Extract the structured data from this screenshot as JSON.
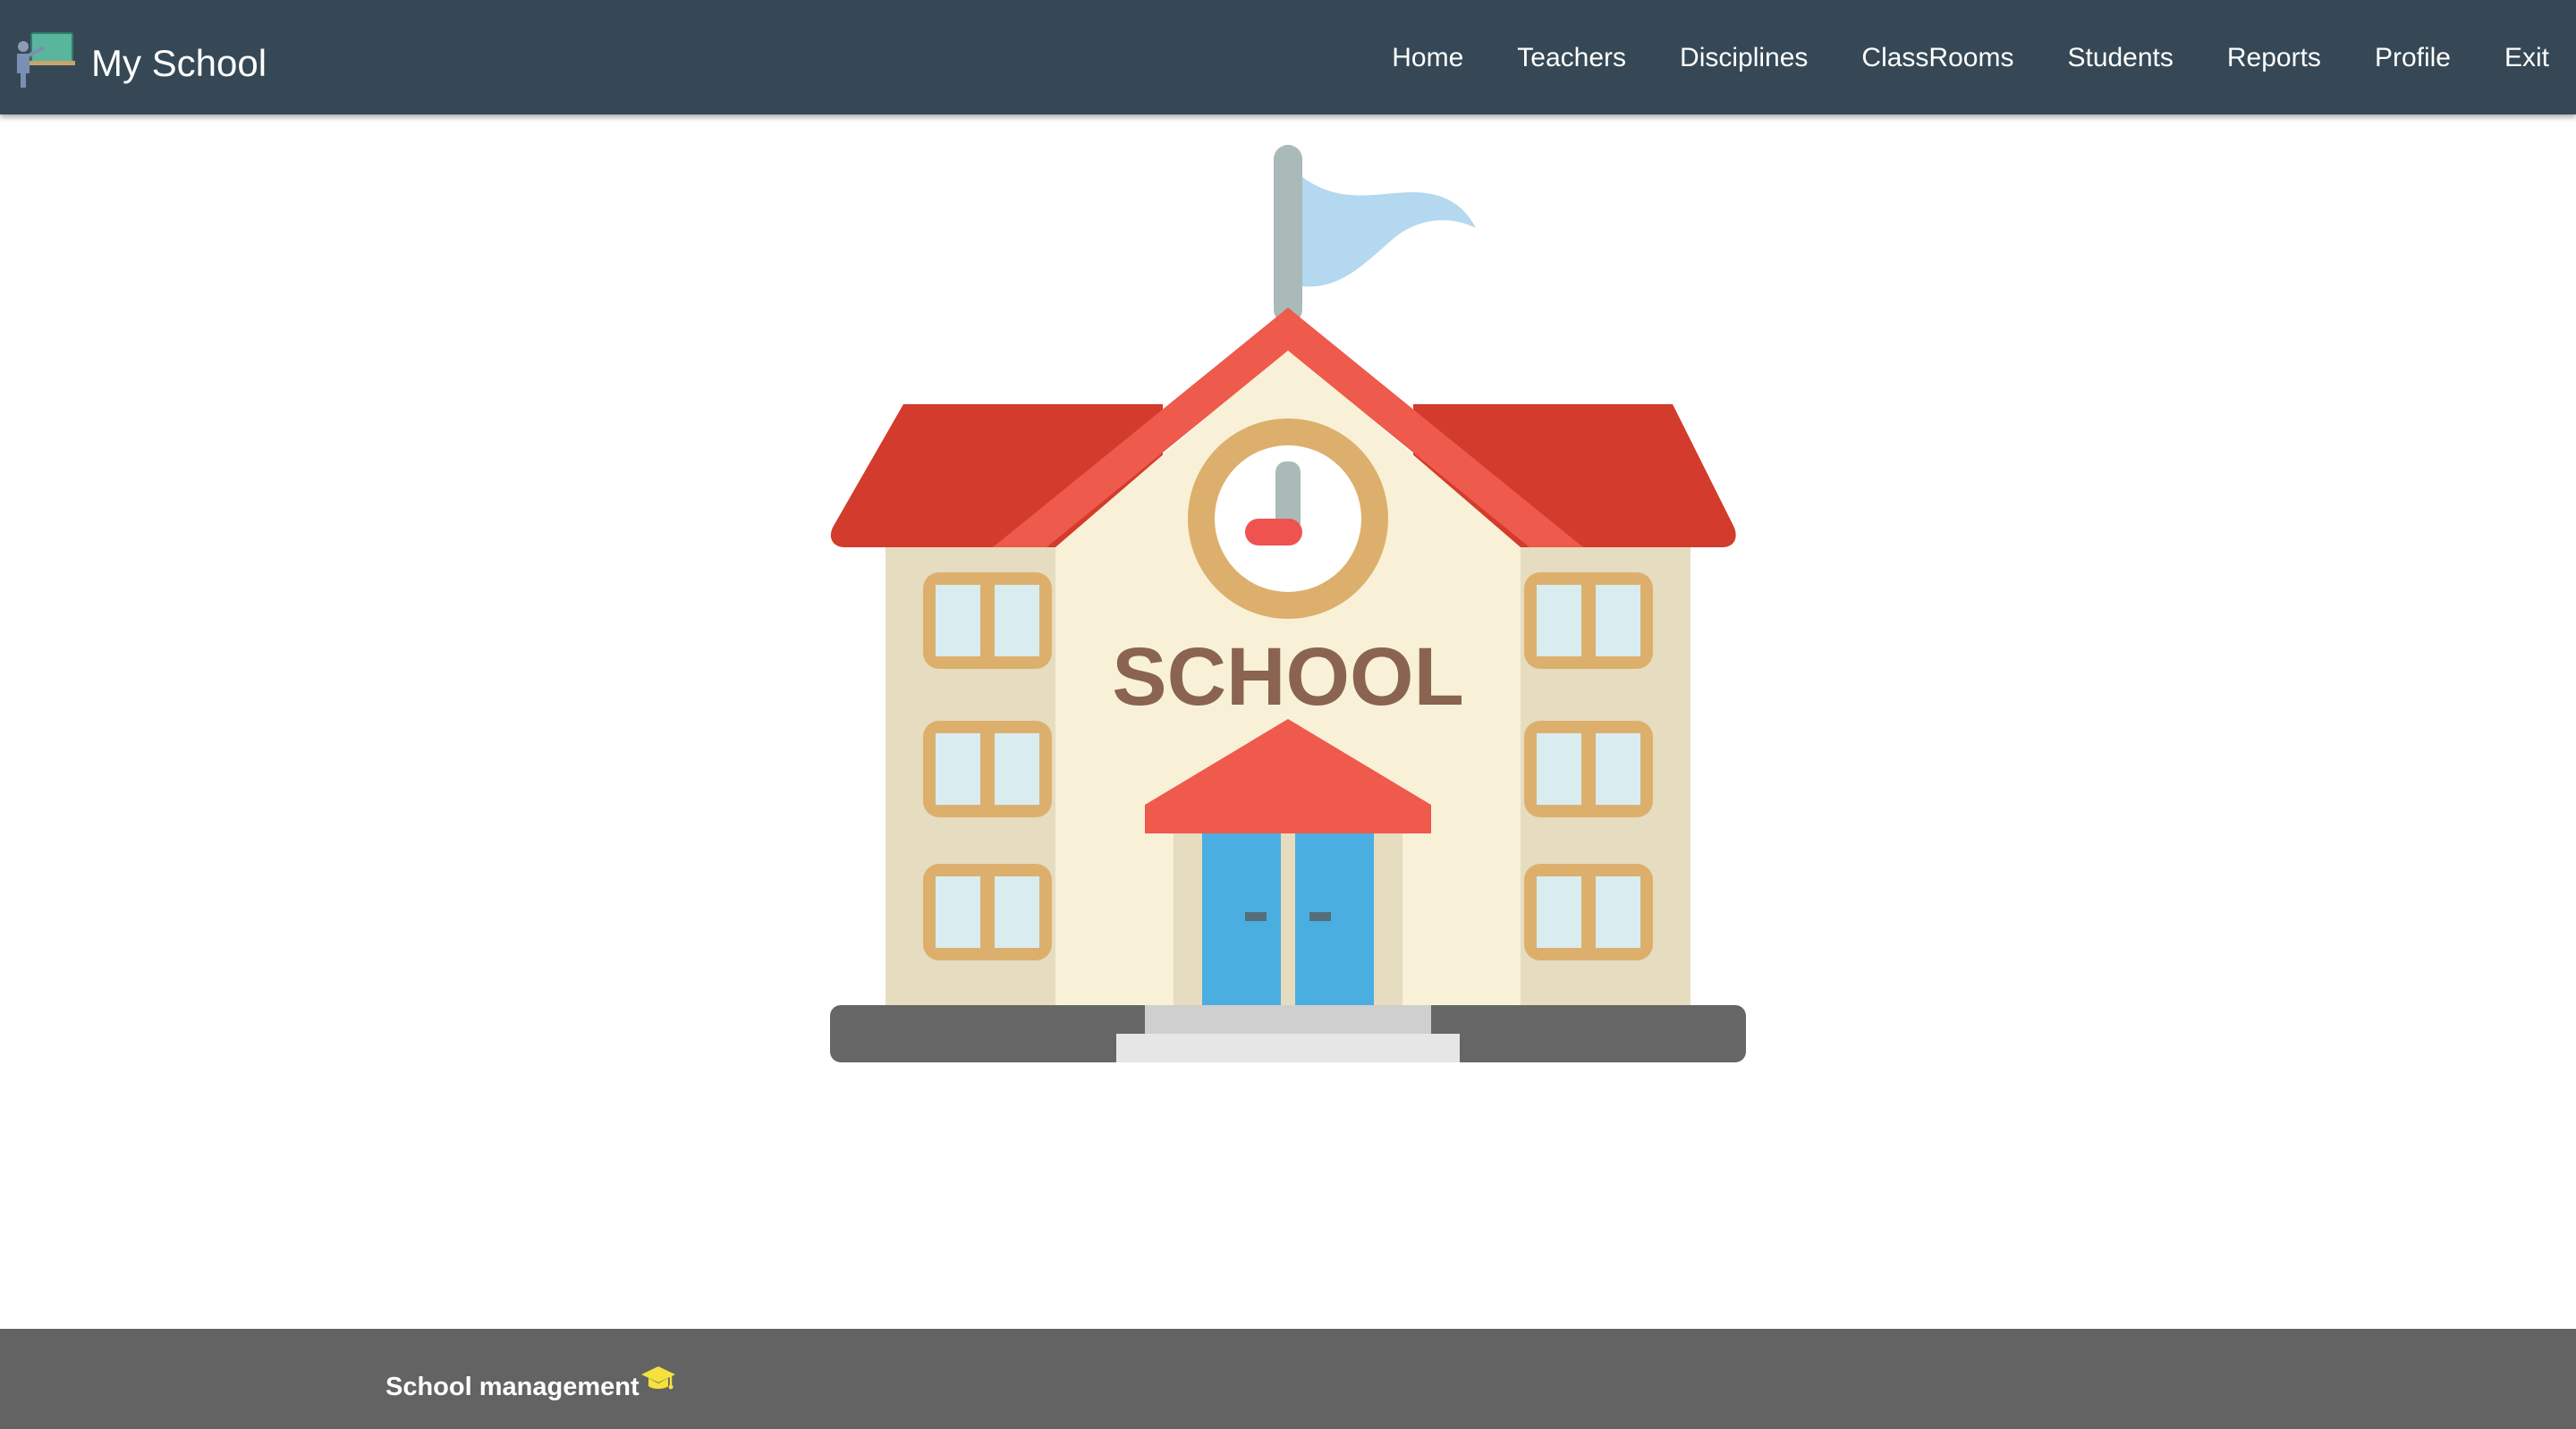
{
  "header": {
    "brand_title": "My School",
    "brand_icon": "teacher-blackboard-icon",
    "nav": [
      {
        "label": "Home"
      },
      {
        "label": "Teachers"
      },
      {
        "label": "Disciplines"
      },
      {
        "label": "ClassRooms"
      },
      {
        "label": "Students"
      },
      {
        "label": "Reports"
      },
      {
        "label": "Profile"
      },
      {
        "label": "Exit"
      }
    ],
    "background_color": "#364855"
  },
  "main": {
    "illustration": "school-building-icon",
    "sign_text": "SCHOOL"
  },
  "footer": {
    "text": "School management",
    "icon": "graduation-cap-icon",
    "background_color": "#636363"
  }
}
